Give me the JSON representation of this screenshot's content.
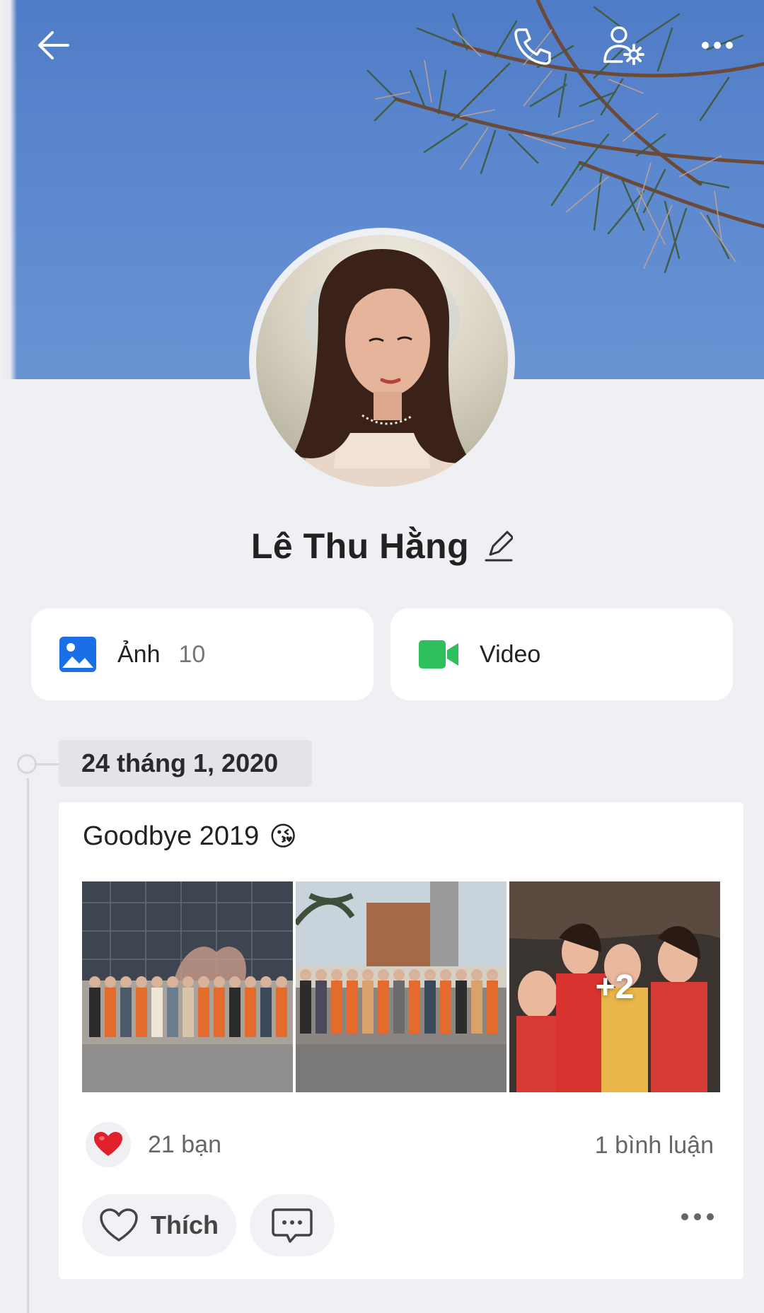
{
  "header": {
    "back_icon": "arrow-left-icon",
    "call_icon": "phone-icon",
    "settings_icon": "user-settings-icon",
    "more_icon": "more-horizontal-icon"
  },
  "profile": {
    "name": "Lê Thu Hằng",
    "edit_icon": "pencil-icon"
  },
  "media": {
    "photos": {
      "label": "Ảnh",
      "count": "10",
      "icon": "image-icon",
      "color": "#1a6ee6"
    },
    "videos": {
      "label": "Video",
      "icon": "video-camera-icon",
      "color": "#2fc05e"
    }
  },
  "timeline": {
    "date": "24 tháng 1, 2020"
  },
  "post": {
    "text": "Goodbye 2019",
    "emoji": "😘",
    "photos": [
      {
        "name": "group-photo-1"
      },
      {
        "name": "group-photo-2"
      },
      {
        "name": "group-photo-3",
        "more": "+2"
      }
    ],
    "reactions": {
      "icon": "heart-icon",
      "count_text": "21 bạn",
      "color": "#e0202a"
    },
    "comments_text": "1 bình luận",
    "like_label": "Thích"
  }
}
